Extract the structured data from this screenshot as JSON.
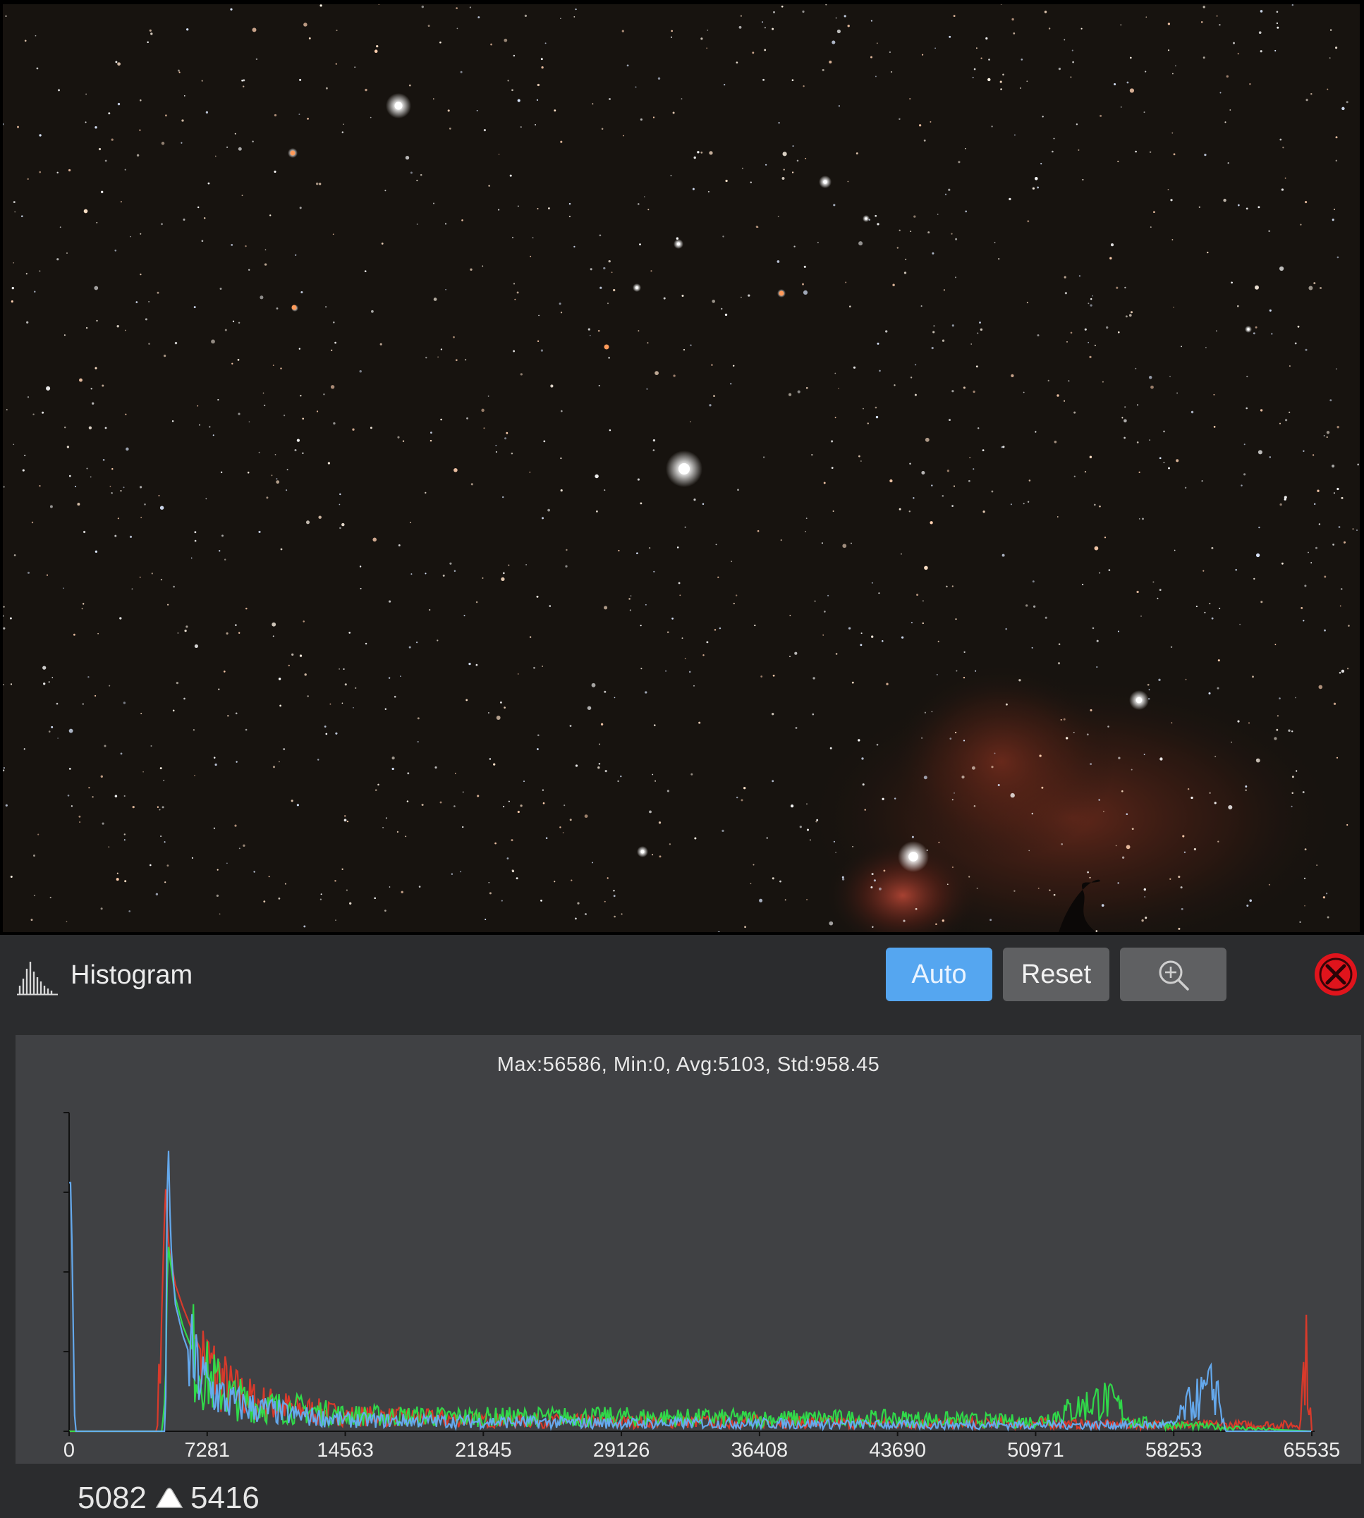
{
  "image_view": {
    "description_icon": "starfield-image"
  },
  "histogram": {
    "title": "Histogram",
    "icon": "histogram-icon",
    "buttons": {
      "auto": "Auto",
      "reset": "Reset",
      "zoom_icon": "zoom-in-icon",
      "close_icon": "close-icon"
    },
    "stats": "Max:56586, Min:0, Avg:5103, Std:958.45",
    "black_point": "5082",
    "white_point": "5416",
    "colors": {
      "accent": "#55a6f0",
      "red": "#e03a2a",
      "green": "#2fe04a",
      "blue": "#66aef5",
      "close": "#e0141c"
    }
  },
  "chart_data": {
    "type": "area",
    "title": "",
    "xlabel": "",
    "ylabel": "",
    "xlim": [
      0,
      65535
    ],
    "x_ticks": [
      "0",
      "7281",
      "14563",
      "21845",
      "29126",
      "36408",
      "43690",
      "50971",
      "58253",
      "65535"
    ],
    "series": [
      {
        "name": "",
        "color": "red",
        "x": [
          0,
          4600,
          4800,
          5082,
          5200,
          5300,
          5600,
          6000,
          6600,
          7281,
          8500,
          10000,
          12000,
          14563,
          21845,
          29126,
          36408,
          43690,
          50971,
          56000,
          58253,
          64900,
          65200,
          65535
        ],
        "y": [
          0,
          0,
          0.2,
          0.78,
          0.62,
          0.56,
          0.46,
          0.39,
          0.3,
          0.21,
          0.13,
          0.09,
          0.07,
          0.05,
          0.035,
          0.03,
          0.03,
          0.025,
          0.025,
          0.02,
          0.02,
          0.02,
          0.26,
          0.0
        ]
      },
      {
        "name": "",
        "color": "green",
        "x": [
          0,
          4900,
          5082,
          5200,
          5300,
          5600,
          6000,
          6600,
          7281,
          8500,
          10000,
          12000,
          14563,
          21845,
          29126,
          36408,
          43690,
          50971,
          54500,
          55300,
          56000,
          58253,
          65535
        ],
        "y": [
          0,
          0,
          0.1,
          0.6,
          0.55,
          0.42,
          0.33,
          0.24,
          0.17,
          0.11,
          0.08,
          0.07,
          0.05,
          0.045,
          0.045,
          0.04,
          0.04,
          0.03,
          0.1,
          0.08,
          0.03,
          0.02,
          0.0
        ]
      },
      {
        "name": "",
        "color": "blue",
        "x": [
          0,
          100,
          300,
          5082,
          5200,
          5300,
          5400,
          5600,
          6000,
          6600,
          7281,
          8500,
          10000,
          12000,
          14563,
          21845,
          29126,
          36408,
          43690,
          50971,
          58253,
          59000,
          60000,
          60500,
          61000,
          65535
        ],
        "y": [
          0.78,
          0.78,
          0,
          0,
          1.0,
          0.72,
          0.55,
          0.4,
          0.3,
          0.2,
          0.14,
          0.09,
          0.07,
          0.05,
          0.035,
          0.03,
          0.025,
          0.025,
          0.02,
          0.02,
          0.02,
          0.08,
          0.12,
          0.14,
          0.0,
          0.0
        ]
      }
    ],
    "grid": false,
    "legend": "none"
  }
}
